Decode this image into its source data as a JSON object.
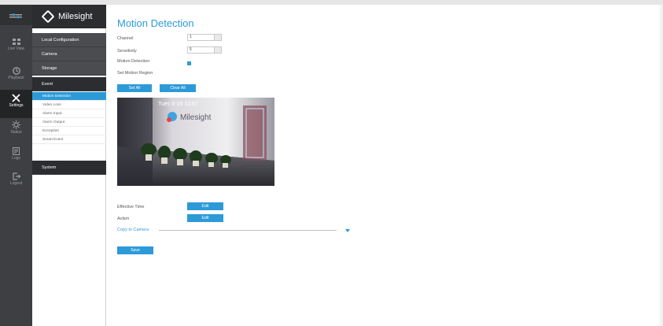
{
  "nav_icons": [
    {
      "name": "live-view",
      "label": "Live View"
    },
    {
      "name": "playback",
      "label": "Playback"
    },
    {
      "name": "settings",
      "label": "Settings"
    },
    {
      "name": "status",
      "label": "Status"
    },
    {
      "name": "logs",
      "label": "Logs"
    },
    {
      "name": "logout",
      "label": "Logout"
    }
  ],
  "brand": "Milesight",
  "sidebar": {
    "groups": {
      "local_configuration": "Local Configuration",
      "camera": "Camera",
      "storage": "Storage",
      "event": "Event",
      "system": "System"
    },
    "event_items": [
      "Motion Detection",
      "Video Loss",
      "Alarm Input",
      "Alarm Output",
      "Exception",
      "Smart Event"
    ]
  },
  "page": {
    "title": "Motion Detection",
    "channel_label": "Channel",
    "channel_value": "1",
    "sensitivity_label": "Sensitivity",
    "sensitivity_value": "5",
    "motion_detection_label": "Motion Detection",
    "motion_detection_checked": true,
    "set_motion_region_label": "Set Motion Region",
    "set_all": "Set All",
    "clear_all": "Clear All",
    "preview_overlay": "Tues 6-16 13:57",
    "effective_time_label": "Effective Time",
    "action_label": "Action",
    "edit": "Edit",
    "copy_to_camera": "Copy to Camera",
    "save": "Save"
  },
  "colors": {
    "accent": "#2d9ad8",
    "sidebar_dark": "#2b2d30",
    "iconbar": "#3d3f42"
  }
}
